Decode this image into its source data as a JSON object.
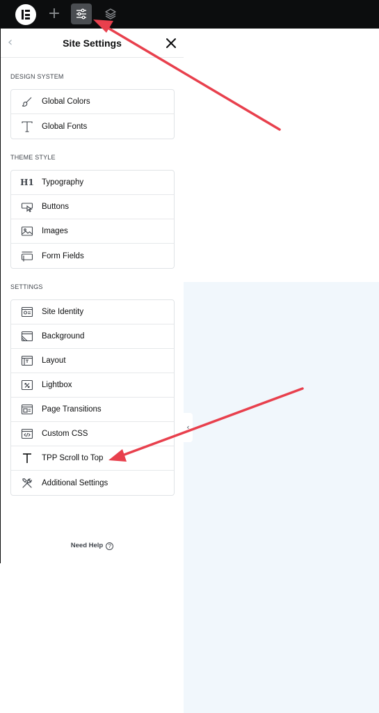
{
  "panel": {
    "title": "Site Settings"
  },
  "sections": [
    {
      "title": "DESIGN SYSTEM",
      "items": [
        {
          "label": "Global Colors",
          "icon": "brush-icon"
        },
        {
          "label": "Global Fonts",
          "icon": "typography-t-icon"
        }
      ]
    },
    {
      "title": "THEME STYLE",
      "items": [
        {
          "label": "Typography",
          "icon": "h1-icon"
        },
        {
          "label": "Buttons",
          "icon": "button-pointer-icon"
        },
        {
          "label": "Images",
          "icon": "image-icon"
        },
        {
          "label": "Form Fields",
          "icon": "form-field-icon"
        }
      ]
    },
    {
      "title": "SETTINGS",
      "items": [
        {
          "label": "Site Identity",
          "icon": "site-identity-icon"
        },
        {
          "label": "Background",
          "icon": "background-icon"
        },
        {
          "label": "Layout",
          "icon": "layout-icon"
        },
        {
          "label": "Lightbox",
          "icon": "lightbox-icon"
        },
        {
          "label": "Page Transitions",
          "icon": "page-transitions-icon"
        },
        {
          "label": "Custom CSS",
          "icon": "code-icon"
        },
        {
          "label": "TPP Scroll to Top",
          "icon": "scroll-to-top-icon"
        },
        {
          "label": "Additional Settings",
          "icon": "tools-icon"
        }
      ]
    }
  ],
  "footer": {
    "need_help": "Need Help"
  },
  "colors": {
    "topbar": "#0c0d0e",
    "canvas": "#f1f7fc",
    "annotation_arrow": "#e8404d"
  }
}
